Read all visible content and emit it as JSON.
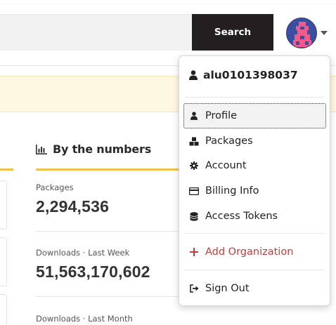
{
  "header": {
    "search_button_label": "Search"
  },
  "stats": {
    "heading": "By the numbers",
    "items": [
      {
        "label": "Packages",
        "value": "2,294,536"
      },
      {
        "label": "Downloads · Last Week",
        "value": "51,563,170,602"
      },
      {
        "label": "Downloads · Last Month",
        "value": ""
      }
    ]
  },
  "user_menu": {
    "username": "alu0101398037",
    "items": [
      {
        "label": "Profile",
        "icon": "user-icon"
      },
      {
        "label": "Packages",
        "icon": "packages-icon"
      },
      {
        "label": "Account",
        "icon": "gear-icon"
      },
      {
        "label": "Billing Info",
        "icon": "credit-card-icon"
      },
      {
        "label": "Access Tokens",
        "icon": "tokens-icon"
      }
    ],
    "add_org_label": "Add Organization",
    "sign_out_label": "Sign Out"
  },
  "colors": {
    "accent_yellow": "#f0c14b",
    "brand_red": "#cb3837",
    "search_button_bg": "#231f20",
    "banner_bg": "#fff8e1"
  }
}
